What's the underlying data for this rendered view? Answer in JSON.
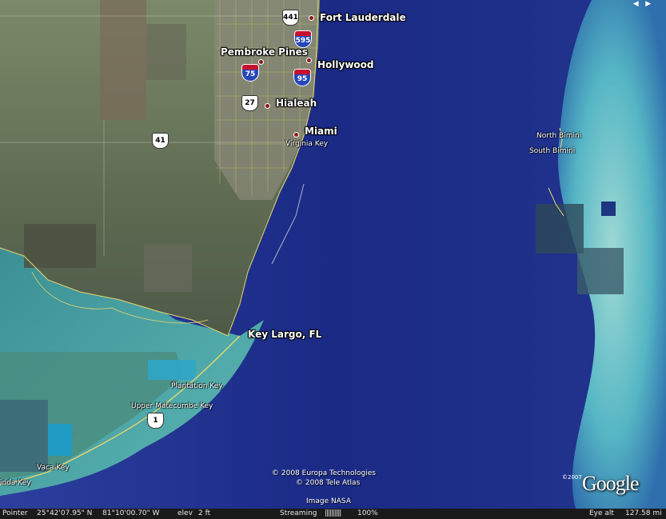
{
  "cities": [
    {
      "name": "Fort Lauderdale"
    },
    {
      "name": "Pembroke Pines"
    },
    {
      "name": "Hollywood"
    },
    {
      "name": "Hialeah"
    },
    {
      "name": "Miami"
    },
    {
      "name": "Key Largo, FL"
    }
  ],
  "places": [
    {
      "name": "Virginia Key"
    },
    {
      "name": "North Bimini"
    },
    {
      "name": "South Bimini"
    },
    {
      "name": "Plantation Key"
    },
    {
      "name": "Upper Matecumbe Key"
    },
    {
      "name": "Vaca Key"
    },
    {
      "name": "inda Key"
    }
  ],
  "shields": [
    {
      "type": "us",
      "number": "441"
    },
    {
      "type": "interstate",
      "number": "595"
    },
    {
      "type": "interstate",
      "number": "75"
    },
    {
      "type": "interstate",
      "number": "95"
    },
    {
      "type": "us",
      "number": "27"
    },
    {
      "type": "us",
      "number": "41"
    },
    {
      "type": "us",
      "number": "1"
    }
  ],
  "copyright": {
    "line1": "© 2008 Europa Technologies",
    "line2": "© 2008 Tele Atlas",
    "line3": "Image NASA"
  },
  "logo": {
    "text": "Google",
    "year": "©2007"
  },
  "statusbar": {
    "pointer_label": "Pointer",
    "lat": "25°42'07.95\" N",
    "lon": "81°10'00.70\" W",
    "elev_label": "elev",
    "elev_value": "2 ft",
    "streaming_label": "Streaming",
    "streaming_bar": "||||||||||",
    "streaming_pct": "100%",
    "eye_alt_label": "Eye alt",
    "eye_alt_value": "127.58 mi"
  },
  "colors": {
    "ocean_deep": "#1e2f8a",
    "ocean_shallow": "#4fb7c7",
    "land": "#6f7a5e",
    "road": "#e6d46a",
    "city_dot": "#8b1a1a"
  }
}
